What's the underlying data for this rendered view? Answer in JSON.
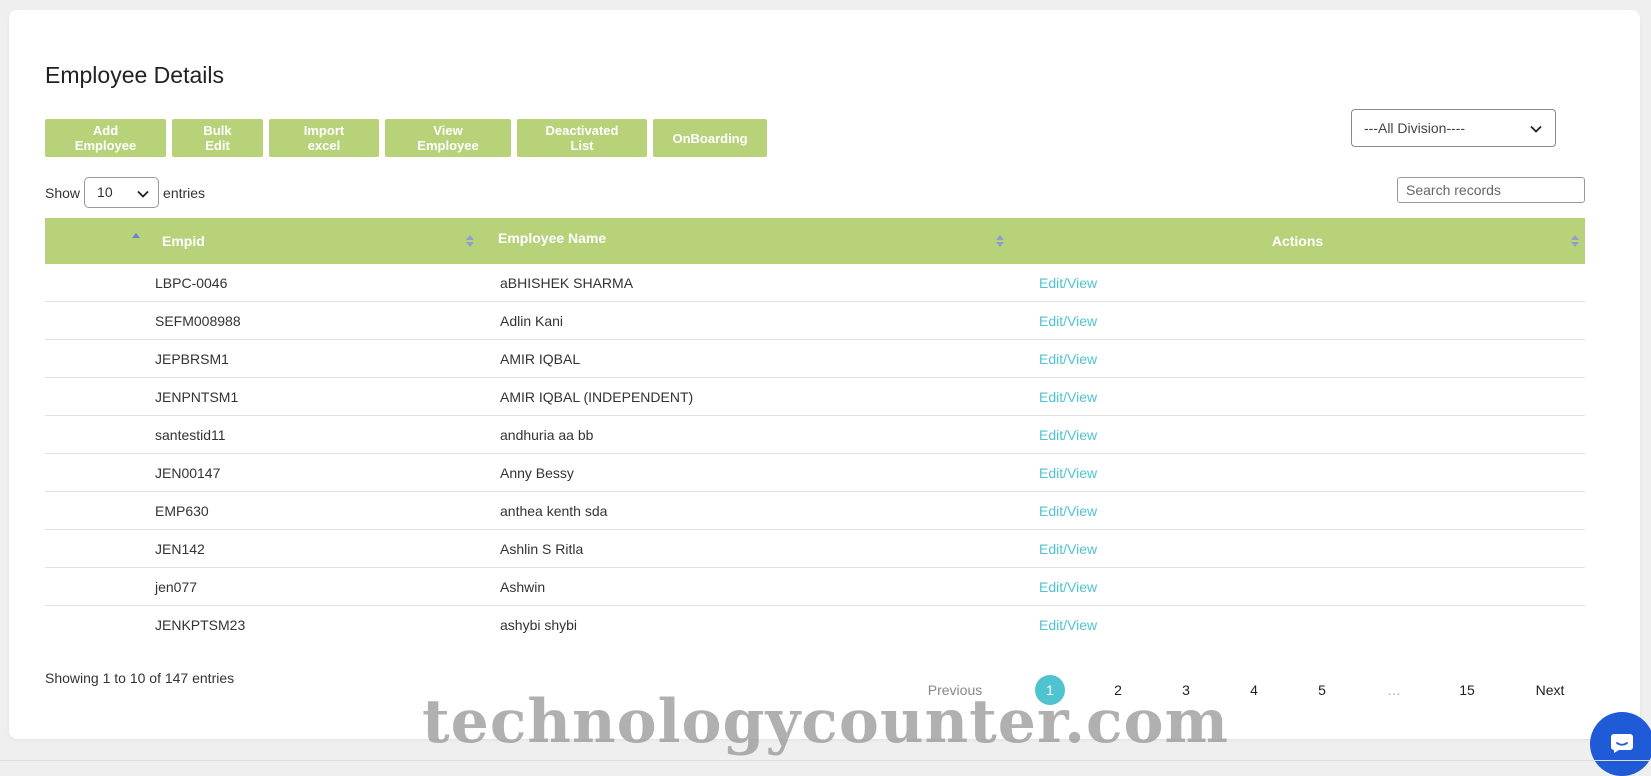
{
  "page": {
    "title": "Employee Details"
  },
  "toolbar": {
    "buttons": [
      {
        "label": "Add Employee"
      },
      {
        "label": "Bulk Edit"
      },
      {
        "label": "Import excel"
      },
      {
        "label": "View Employee"
      },
      {
        "label": "Deactivated List"
      },
      {
        "label": "OnBoarding"
      }
    ],
    "division_select": {
      "value": "---All Division----"
    }
  },
  "length": {
    "show_label": "Show",
    "value": "10",
    "entries_label": "entries"
  },
  "search": {
    "placeholder": "Search records"
  },
  "table": {
    "headers": [
      "",
      "Empid",
      "Employee Name",
      "Actions"
    ],
    "rows": [
      {
        "empid": "LBPC-0046",
        "name": "aBHISHEK SHARMA",
        "action": "Edit/View"
      },
      {
        "empid": "SEFM008988",
        "name": "Adlin Kani",
        "action": "Edit/View"
      },
      {
        "empid": "JEPBRSM1",
        "name": "AMIR IQBAL",
        "action": "Edit/View"
      },
      {
        "empid": "JENPNTSM1",
        "name": "AMIR IQBAL (INDEPENDENT)",
        "action": "Edit/View"
      },
      {
        "empid": "santestid11",
        "name": "andhuria aa bb",
        "action": "Edit/View"
      },
      {
        "empid": "JEN00147",
        "name": "Anny Bessy",
        "action": "Edit/View"
      },
      {
        "empid": "EMP630",
        "name": "anthea kenth sda",
        "action": "Edit/View"
      },
      {
        "empid": "JEN142",
        "name": "Ashlin S Ritla",
        "action": "Edit/View"
      },
      {
        "empid": "jen077",
        "name": "Ashwin",
        "action": "Edit/View"
      },
      {
        "empid": "JENKPTSM23",
        "name": "ashybi shybi",
        "action": "Edit/View"
      }
    ]
  },
  "footer": {
    "info": "Showing 1 to 10 of 147 entries",
    "pagination": {
      "previous": "Previous",
      "pages": [
        "1",
        "2",
        "3",
        "4",
        "5",
        "…",
        "15"
      ],
      "current": "1",
      "next": "Next"
    }
  },
  "watermark": "technologycounter.com",
  "colors": {
    "accent_green": "#b8d27a",
    "link_teal": "#4fc3cf",
    "chat_blue": "#1f5bd6"
  },
  "icons": {
    "sort": "sort-arrows-icon",
    "chevron": "chevron-down-icon",
    "chat": "chat-bubble-icon"
  }
}
